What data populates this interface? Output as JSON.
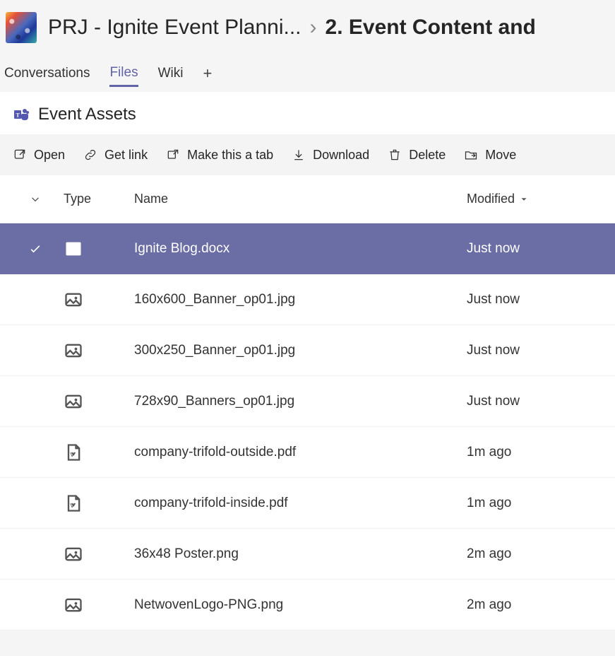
{
  "header": {
    "team_name": "PRJ - Ignite Event Planni...",
    "separator": "›",
    "channel_name": "2. Event Content and"
  },
  "tabs": {
    "items": [
      {
        "label": "Conversations",
        "active": false
      },
      {
        "label": "Files",
        "active": true
      },
      {
        "label": "Wiki",
        "active": false
      }
    ],
    "add_label": "+"
  },
  "panel": {
    "title": "Event Assets"
  },
  "toolbar": {
    "open": "Open",
    "get_link": "Get link",
    "make_tab": "Make this a tab",
    "download": "Download",
    "delete": "Delete",
    "move": "Move"
  },
  "columns": {
    "type": "Type",
    "name": "Name",
    "modified": "Modified"
  },
  "files": [
    {
      "name": "Ignite Blog.docx",
      "modified": "Just now",
      "type": "word",
      "selected": true
    },
    {
      "name": "160x600_Banner_op01.jpg",
      "modified": "Just now",
      "type": "image",
      "selected": false
    },
    {
      "name": "300x250_Banner_op01.jpg",
      "modified": "Just now",
      "type": "image",
      "selected": false
    },
    {
      "name": "728x90_Banners_op01.jpg",
      "modified": "Just now",
      "type": "image",
      "selected": false
    },
    {
      "name": "company-trifold-outside.pdf",
      "modified": "1m ago",
      "type": "pdf",
      "selected": false
    },
    {
      "name": "company-trifold-inside.pdf",
      "modified": "1m ago",
      "type": "pdf",
      "selected": false
    },
    {
      "name": "36x48 Poster.png",
      "modified": "2m ago",
      "type": "image",
      "selected": false
    },
    {
      "name": "NetwovenLogo-PNG.png",
      "modified": "2m ago",
      "type": "image",
      "selected": false
    }
  ]
}
